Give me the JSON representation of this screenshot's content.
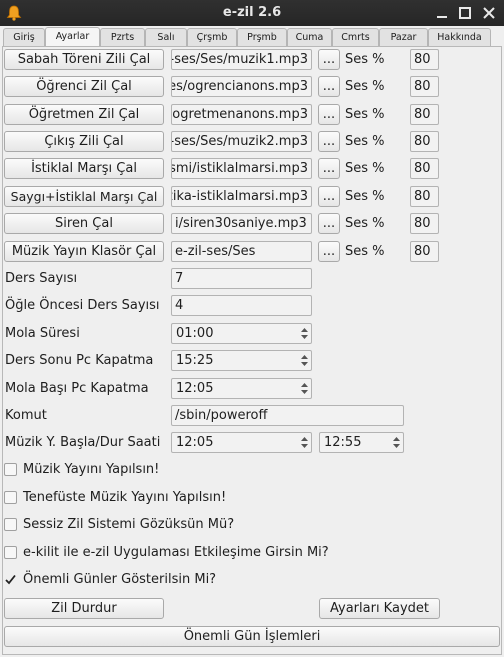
{
  "window": {
    "title": "e-zil 2.6"
  },
  "tabs": [
    "Giriş",
    "Ayarlar",
    "Pzrts",
    "Salı",
    "Çrşmb",
    "Prşmb",
    "Cuma",
    "Cmrts",
    "Pazar",
    "Hakkında"
  ],
  "bell_rows": [
    {
      "button": "Sabah Töreni Zili Çal",
      "path": "-ses/Ses/muzik1.mp3",
      "browse": "...",
      "ses_label": "Ses %",
      "volume": "80"
    },
    {
      "button": "Öğrenci Zil Çal",
      "path": "es/ogrencianons.mp3",
      "browse": "...",
      "ses_label": "Ses %",
      "volume": "80"
    },
    {
      "button": "Öğretmen Zil Çal",
      "path": "ogretmenanons.mp3",
      "browse": "...",
      "ses_label": "Ses %",
      "volume": "80"
    },
    {
      "button": "Çıkış Zili Çal",
      "path": "-ses/Ses/muzik2.mp3",
      "browse": "...",
      "ses_label": "Ses %",
      "volume": "80"
    },
    {
      "button": "İstiklal Marşı Çal",
      "path": "smi/istiklalmarsi.mp3",
      "browse": "...",
      "ses_label": "Ses %",
      "volume": "80"
    },
    {
      "button": "Saygı+İstiklal Marşı Çal",
      "path": "zika-istiklalmarsi.mp3",
      "browse": "...",
      "ses_label": "Ses %",
      "volume": "80"
    },
    {
      "button": "Siren Çal",
      "path": "i/siren30saniye.mp3",
      "browse": "...",
      "ses_label": "Ses %",
      "volume": "80"
    },
    {
      "button": "Müzik Yayın Klasör Çal",
      "path": "e-zil-ses/Ses",
      "browse": "...",
      "ses_label": "Ses %",
      "volume": "80"
    }
  ],
  "settings": {
    "ders_sayisi": {
      "label": "Ders Sayısı",
      "value": "7"
    },
    "ogle_oncesi": {
      "label": "Öğle Öncesi Ders Sayısı",
      "value": "4"
    },
    "mola_suresi": {
      "label": "Mola Süresi",
      "value": "01:00"
    },
    "ders_sonu_pc": {
      "label": "Ders Sonu Pc Kapatma",
      "value": "15:25"
    },
    "mola_basi_pc": {
      "label": "Mola Başı Pc Kapatma",
      "value": "12:05"
    },
    "komut": {
      "label": "Komut",
      "value": "/sbin/poweroff"
    },
    "muzik_saati": {
      "label": "Müzik Y. Başla/Dur Saati",
      "start": "12:05",
      "end": "12:55"
    }
  },
  "checks": [
    {
      "label": "Müzik Yayını Yapılsın!",
      "checked": false
    },
    {
      "label": "Tenefüste Müzik Yayını Yapılsın!",
      "checked": false
    },
    {
      "label": "Sessiz Zil Sistemi Gözüksün Mü?",
      "checked": false
    },
    {
      "label": "e-kilit ile e-zil Uygulaması Etkileşime Girsin Mi?",
      "checked": false
    },
    {
      "label": "Önemli Günler Gösterilsin Mi?",
      "checked": true
    }
  ],
  "actions": {
    "stop": "Zil Durdur",
    "save": "Ayarları Kaydet",
    "important_days": "Önemli Gün İşlemleri"
  }
}
